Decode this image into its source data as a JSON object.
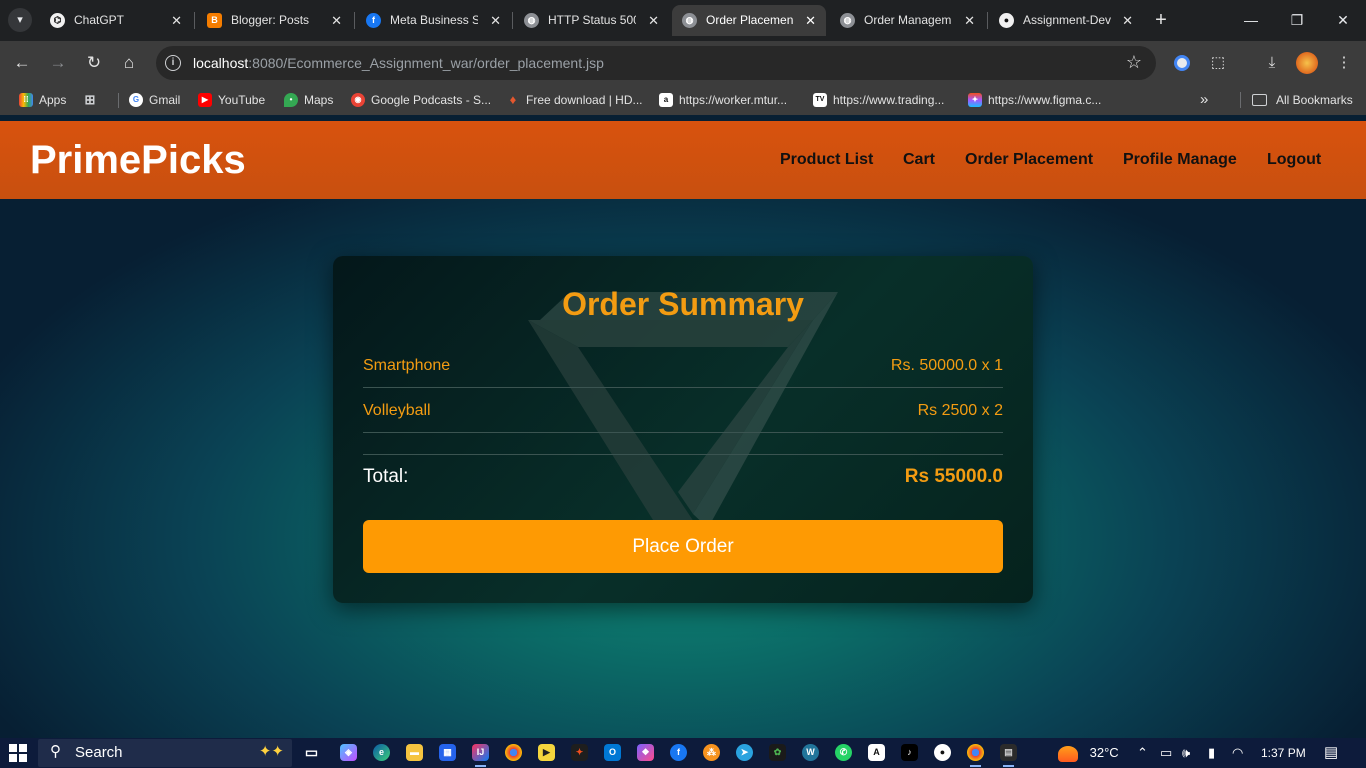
{
  "browser": {
    "tabs": [
      {
        "title": "ChatGPT",
        "icon": "chatgpt-icon",
        "active": false
      },
      {
        "title": "Blogger: Posts",
        "icon": "blogger-icon",
        "active": false
      },
      {
        "title": "Meta Business S",
        "icon": "facebook-icon",
        "active": false
      },
      {
        "title": "HTTP Status 500",
        "icon": "globe-icon",
        "active": false
      },
      {
        "title": "Order Placemen",
        "icon": "globe-icon",
        "active": true
      },
      {
        "title": "Order Managem",
        "icon": "globe-icon",
        "active": false
      },
      {
        "title": "Assignment-Dev",
        "icon": "github-icon",
        "active": false
      }
    ],
    "new_tab": "+",
    "address": {
      "host": "localhost",
      "rest": ":8080/Ecommerce_Assignment_war/order_placement.jsp"
    },
    "bookmarks": [
      {
        "label": "Apps",
        "icon": "apps-grid-icon",
        "color": "#4285f4"
      },
      {
        "label": "",
        "icon": "tab-groups-icon",
        "color": "#9aa0a6"
      },
      {
        "label": "Gmail",
        "icon": "google-icon",
        "color": "#ea4335"
      },
      {
        "label": "YouTube",
        "icon": "youtube-icon",
        "color": "#ff0000"
      },
      {
        "label": "Maps",
        "icon": "maps-pin-icon",
        "color": "#34a853"
      },
      {
        "label": "Google Podcasts - S...",
        "icon": "podcasts-icon",
        "color": "#ea4335"
      },
      {
        "label": "Free download | HD...",
        "icon": "flame-icon",
        "color": "#e4572e"
      },
      {
        "label": "https://worker.mtur...",
        "icon": "amazon-icon",
        "color": "#ffffff"
      },
      {
        "label": "https://www.trading...",
        "icon": "tradingview-icon",
        "color": "#ffffff"
      },
      {
        "label": "https://www.figma.c...",
        "icon": "figma-icon",
        "color": "#f24e1e"
      }
    ],
    "overflow": "»",
    "all_bookmarks": "All Bookmarks"
  },
  "site": {
    "brand": "PrimePicks",
    "nav": [
      "Product List",
      "Cart",
      "Order Placement",
      "Profile Manage",
      "Logout"
    ]
  },
  "summary": {
    "title": "Order Summary",
    "items": [
      {
        "name": "Smartphone",
        "price": "Rs. 50000.0 x 1"
      },
      {
        "name": "Volleyball",
        "price": "Rs 2500 x 2"
      }
    ],
    "total_label": "Total:",
    "total_value": "Rs 55000.0",
    "button": "Place Order",
    "accent": "#f39c12",
    "button_color": "#fe9a03",
    "header_color": "#d8520e"
  },
  "taskbar": {
    "search_placeholder": "Search",
    "weather_temp": "32°C",
    "clock": "1:37 PM"
  }
}
